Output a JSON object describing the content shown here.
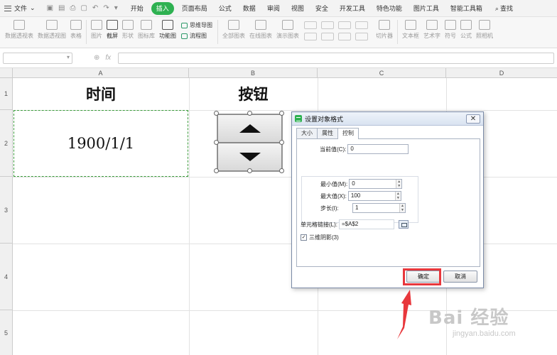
{
  "menubar": {
    "file_label": "文件",
    "tabs": [
      "开始",
      "插入",
      "页面布局",
      "公式",
      "数据",
      "审阅",
      "视图",
      "安全",
      "开发工具",
      "特色功能",
      "图片工具",
      "智能工具箱"
    ],
    "active_tab": "插入",
    "search_label": "查找"
  },
  "ribbon": {
    "items": [
      "数据透视表",
      "数据透视图",
      "表格",
      "图片",
      "截屏",
      "形状",
      "图标库",
      "功能图"
    ],
    "stack_items": [
      "思维导图",
      "流程图"
    ],
    "right_items": [
      "全部图表",
      "在线图表",
      "演示图表",
      "切片器",
      "文本框",
      "艺术字",
      "符号",
      "公式",
      "照相机"
    ]
  },
  "formula": {
    "fx_label": "fx"
  },
  "sheet": {
    "columns": [
      "A",
      "B",
      "C",
      "D"
    ],
    "rows": [
      "1",
      "2",
      "3",
      "4",
      "5"
    ],
    "a1": "时间",
    "b1": "按钮",
    "a2": "1900/1/1"
  },
  "dialog": {
    "title": "设置对象格式",
    "tabs": [
      "大小",
      "属性",
      "控制"
    ],
    "active_tab": "控制",
    "current_value_label": "当前值(C):",
    "current_value": "0",
    "min_label": "最小值(M):",
    "min_value": "0",
    "max_label": "最大值(X):",
    "max_value": "100",
    "step_label": "步长(I):",
    "step_value": "1",
    "link_label": "单元格链接(L):",
    "link_value": "=$A$2",
    "shading_label": "三维阴影(3)",
    "shading_checked": "✓",
    "ok_label": "确定",
    "cancel_label": "取消",
    "close_glyph": "✕"
  },
  "watermark": {
    "main": "Bai 经验",
    "sub": "jingyan.baidu.com"
  },
  "colors": {
    "accent": "#2eb151",
    "highlight": "#e8373c",
    "selection": "#3a9b3a"
  }
}
